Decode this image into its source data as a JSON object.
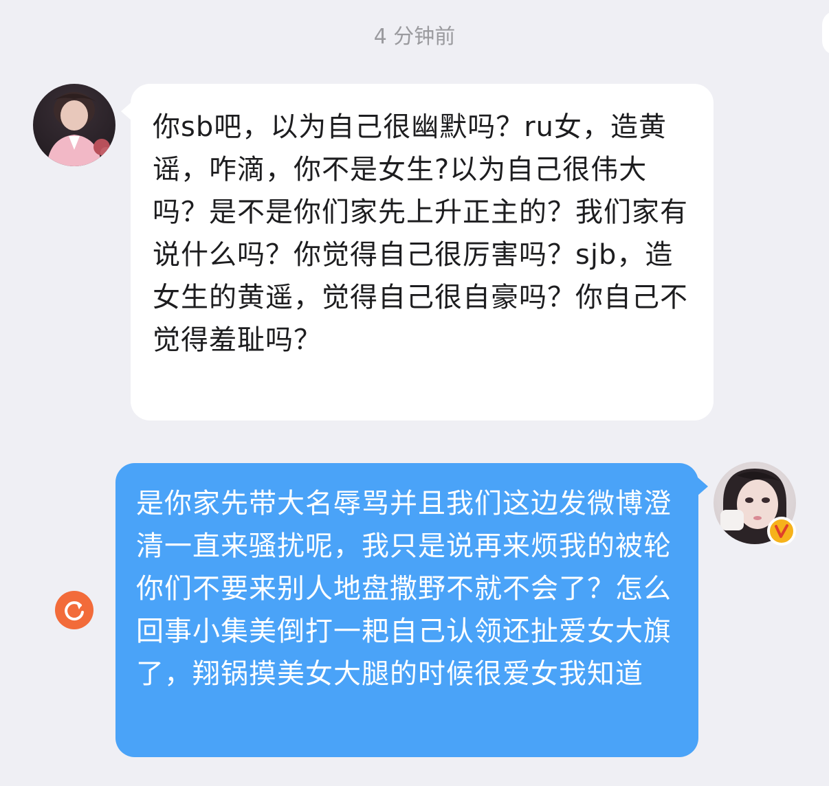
{
  "header": {
    "timestamp": "4 分钟前"
  },
  "messages": [
    {
      "direction": "incoming",
      "text": "你sb吧，以为自己很幽默吗？ru女，造黄谣，咋滴，你不是女生?以为自己很伟大吗？是不是你们家先上升正主的？我们家有说什么吗？你觉得自己很厉害吗？sjb，造女生的黄遥，觉得自己很自豪吗？你自己不觉得羞耻吗？"
    },
    {
      "direction": "outgoing",
      "text": "是你家先带大名辱骂并且我们这边发微博澄清一直来骚扰呢，我只是说再来烦我的被轮你们不要来别人地盘撒野不就不会了？怎么回事小集美倒打一耙自己认领还扯爱女大旗了，翔锅摸美女大腿的时候很爱女我知道",
      "status": "failed"
    }
  ],
  "icons": {
    "resend": "refresh-icon",
    "verified": "verified-v-icon"
  },
  "colors": {
    "outgoing_bubble": "#4aa3f8",
    "incoming_bubble": "#ffffff",
    "failed_status": "#f26b3a",
    "verified_badge": "#f6b21b",
    "background": "#efeff4"
  }
}
